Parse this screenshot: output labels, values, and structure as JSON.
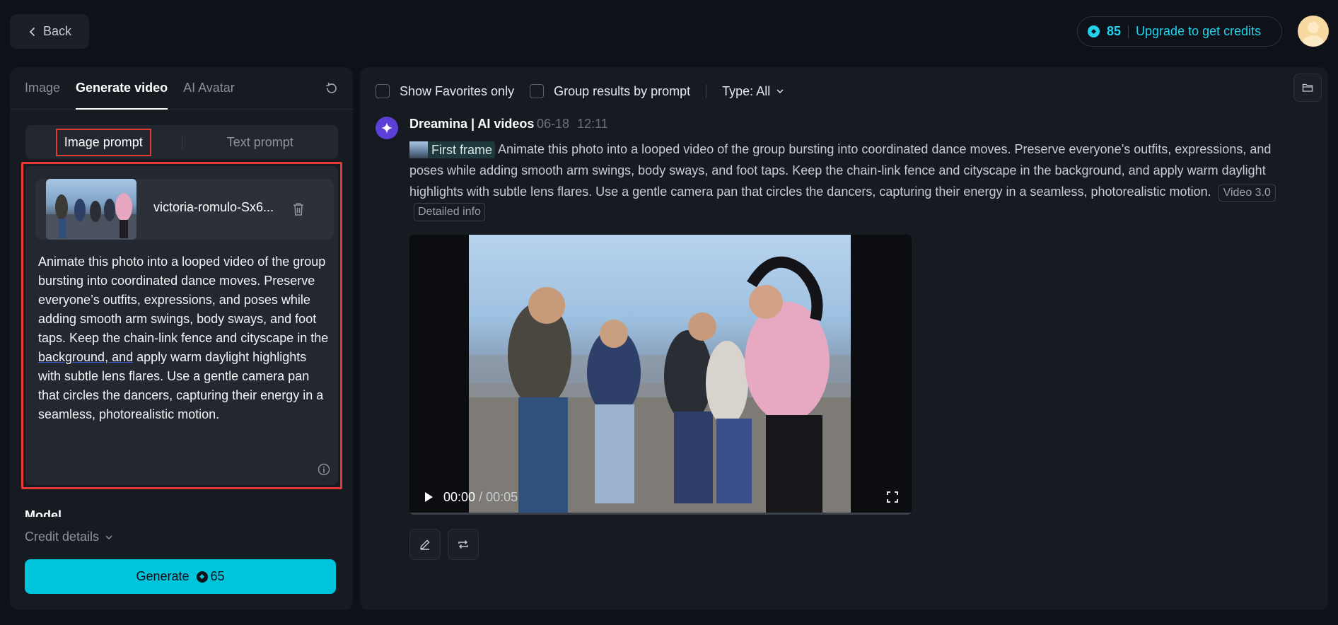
{
  "header": {
    "back_label": "Back",
    "credits": "85",
    "upgrade_label": "Upgrade to get credits"
  },
  "left": {
    "tabs": [
      {
        "label": "Image",
        "active": false
      },
      {
        "label": "Generate video",
        "active": true
      },
      {
        "label": "AI Avatar",
        "active": false
      }
    ],
    "mode": {
      "image_prompt": "Image prompt",
      "text_prompt": "Text prompt",
      "selected": "Image prompt"
    },
    "upload": {
      "file_name": "victoria-romulo-Sx6..."
    },
    "prompt": {
      "part1": "Animate this photo into a looped video of the group bursting into coordinated dance moves. Preserve everyone’s outfits, expressions, and poses while adding smooth arm swings, body sways, and foot taps. Keep the chain-link fence and cityscape in the ",
      "underlined": "background, and",
      "part2": " apply warm daylight highlights with subtle lens flares. Use a gentle camera pan that circles the dancers, capturing their energy in a seamless, photorealistic motion."
    },
    "model_label": "Model",
    "credit_details_label": "Credit details",
    "generate": {
      "label": "Generate",
      "cost": "65"
    }
  },
  "right": {
    "filters": {
      "favorites_label": "Show Favorites only",
      "favorites_checked": false,
      "group_label": "Group results by prompt",
      "group_checked": false,
      "type_label": "Type: All"
    },
    "message": {
      "author": "Dreamina | AI videos",
      "date": "06-18",
      "time": "12:11",
      "frame_chip": "First frame",
      "text": "Animate this photo into a looped video of the group bursting into coordinated dance moves. Preserve everyone’s outfits, expressions, and poses while adding smooth arm swings, body sways, and foot taps. Keep the chain-link fence and cityscape in the background, and apply warm daylight highlights with subtle lens flares. Use a gentle camera pan that circles the dancers, capturing their energy in a seamless, photorealistic motion.",
      "model_tag": "Video 3.0",
      "detail_tag": "Detailed info"
    },
    "video": {
      "current_time": "00:00",
      "separator": "/",
      "duration": "00:05",
      "progress": 0
    }
  },
  "colors": {
    "accent": "#22d3ee",
    "generate_bg": "#00c4dc",
    "highlight": "#e53935",
    "panel": "#161a21",
    "background": "#0e1117"
  }
}
